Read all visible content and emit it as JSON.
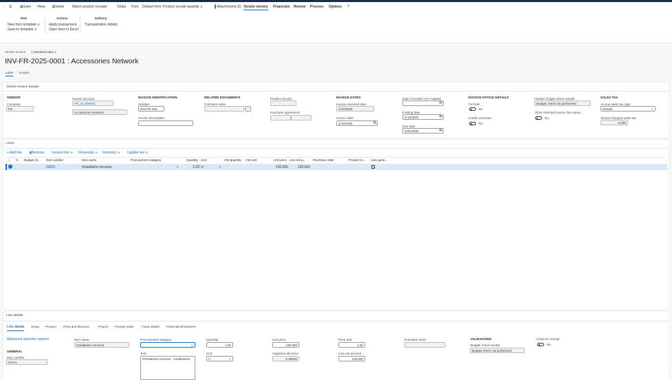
{
  "toolbar": {
    "back": "←",
    "menu": "☰",
    "save": "Save",
    "new": "New",
    "delete": "Delete",
    "match": "Match product receipts",
    "totals": "Totals",
    "post": "Post",
    "default_from": "Default from: Product receipt quantity",
    "attachments": "Attachments (0)",
    "tabs": [
      "Vendor invoice",
      "Financials",
      "Review",
      "Process",
      "Options"
    ],
    "active_tab": "Vendor invoice"
  },
  "ribbon": {
    "groups": [
      {
        "title": "New",
        "items": [
          "New from template",
          "Save to template"
        ]
      },
      {
        "title": "Actions",
        "items": [
          "Apply prepayment",
          "Open lines in Excel"
        ]
      },
      {
        "title": "Delivery",
        "items": [
          "Transportation details"
        ]
      }
    ]
  },
  "breadcrumb": {
    "link": "Vendor invoice",
    "view": "Standard view"
  },
  "page_title": "INV-FR-2025-0001 : Accessories Network",
  "page_tabs": [
    "Lines",
    "Header"
  ],
  "header": {
    "title": "Vendor invoice header",
    "vendor": {
      "section": "VENDOR",
      "company_label": "Company",
      "company": "frsi",
      "invoice_account_label": "Invoice account",
      "invoice_account": "FR_SI_000001",
      "vendor_name": "Accessories Network"
    },
    "identification": {
      "section": "INVOICE IDENTIFICATION",
      "number_label": "Number",
      "number": "INV-FR-202...",
      "description_label": "Invoice description",
      "description": ""
    },
    "related": {
      "section": "RELATED DOCUMENTS",
      "po_label": "Purchase order",
      "po": "",
      "product_receipt_label": "Product receipt",
      "agreement_label": "Purchase agreement"
    },
    "dates": {
      "section": "INVOICE DATES",
      "received_label": "Invoice received date",
      "received": "1/10/2025",
      "invoice_date_label": "Invoice date",
      "invoice_date": "1/10/2025",
      "vat_label": "Date of vendor VAT register",
      "vat": "",
      "posting_label": "Posting date",
      "posting": "1/10/2025",
      "due_label": "Due date",
      "due": "1/25/2025"
    },
    "status": {
      "section": "INVOICE STATUS DETAILS",
      "on_hold_label": "On hold",
      "on_hold": "No",
      "credit_label": "Credit correction",
      "credit": "No",
      "budget_label": "Header budget check results",
      "budget": "Budget check not performed",
      "allow_label": "Allow matched invoice line quant...",
      "allow": "No"
    },
    "tax": {
      "section": "SALES TAX",
      "accrue_label": "Accrue sales tax type",
      "accrue": "Default",
      "charged_label": "Vendor charged sales tax",
      "charged": "0.000"
    }
  },
  "lines": {
    "title": "Lines",
    "actions": [
      "+ Add line",
      "Remove",
      "Invoice line",
      "Financials",
      "Inventory",
      "Update line"
    ],
    "columns": [
      "Budget ch...",
      "Item number",
      "Item name",
      "Procurement category",
      "Quantity",
      "Unit",
      "CW quantity",
      "CW unit",
      "Unit price",
      "Line net a...",
      "Purchase order",
      "Product re...",
      "Auto gene..."
    ],
    "rows": [
      {
        "item_number": "50001",
        "item_name": "Installation services",
        "category": "",
        "quantity": "1.00",
        "unit": "hr",
        "unit_price": "100.000",
        "net": "100.000"
      }
    ]
  },
  "line_details": {
    "title": "Line details",
    "tabs": [
      "Line details",
      "Setup",
      "Product",
      "Price and discount",
      "Project",
      "Foreign trade",
      "Fixed assets",
      "Financial dimensions"
    ],
    "advanced": "Advanced selection options",
    "general": "GENERAL",
    "item_number_label": "Item number",
    "item_number": "50001",
    "item_name_label": "Item name",
    "item_name": "Installation services",
    "category_label": "Procurement category",
    "category": "",
    "text_label": "Text",
    "text": "Prestations services - Installations",
    "quantity_label": "Quantity",
    "quantity": "1.00",
    "unit_label": "Unit",
    "unit": "hr",
    "unit_price_label": "Unit price",
    "unit_price": "100.000",
    "adj_label": "Adjusted unit price",
    "adj": "0.00000",
    "price_unit_label": "Price unit",
    "price_unit": "1.00",
    "net_label": "Line net amount",
    "net": "100.000",
    "po_label": "Purchase order",
    "po": "",
    "validations": "VALIDATIONS",
    "budget_label": "Budget check results",
    "budget": "Budget check not performed",
    "close_label": "Close for receipt",
    "close": "No"
  },
  "colors": {
    "accent": "#0f6cbd",
    "selected_row": "#dbe6f7"
  }
}
